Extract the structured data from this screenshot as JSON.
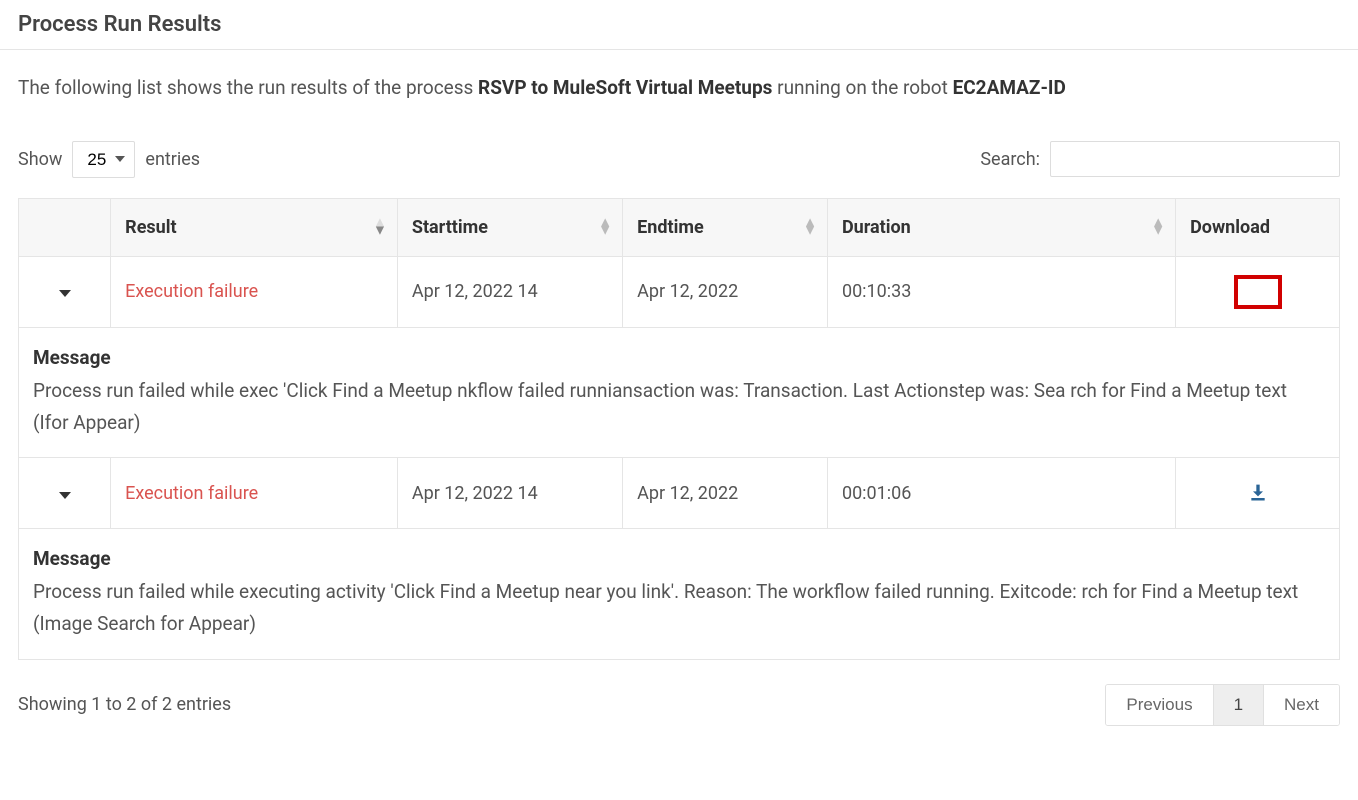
{
  "header": {
    "title": "Process Run Results"
  },
  "description": {
    "prefix": "The following list shows the run results of the process ",
    "process_name": "RSVP to MuleSoft Virtual Meetups",
    "middle": " running on the robot ",
    "robot_name": "EC2AMAZ-ID"
  },
  "controls": {
    "show_label": "Show",
    "entries_label": "entries",
    "page_size": "25",
    "search_label": "Search:"
  },
  "table": {
    "headers": {
      "result": "Result",
      "starttime": "Starttime",
      "endtime": "Endtime",
      "duration": "Duration",
      "download": "Download"
    },
    "rows": [
      {
        "result": "Execution failure",
        "starttime": "Apr 12, 2022 14",
        "endtime": "Apr 12, 2022",
        "duration": "00:10:33",
        "download_highlight": true,
        "message_label": "Message",
        "message": "Process run failed while exec 'Click Find a Meetup nkflow failed runniansaction was: Transaction. Last Actionstep was: Sea rch for Find a Meetup text (Ifor Appear)"
      },
      {
        "result": "Execution failure",
        "starttime": "Apr 12, 2022 14",
        "endtime": "Apr 12, 2022",
        "duration": "00:01:06",
        "download_highlight": false,
        "message_label": "Message",
        "message": "Process run failed while executing activity 'Click Find a Meetup near you link'. Reason: The workflow failed running. Exitcode: rch for Find a Meetup text (Image Search for Appear)"
      }
    ]
  },
  "footer": {
    "info": "Showing 1 to 2 of 2 entries",
    "previous": "Previous",
    "page": "1",
    "next": "Next"
  }
}
